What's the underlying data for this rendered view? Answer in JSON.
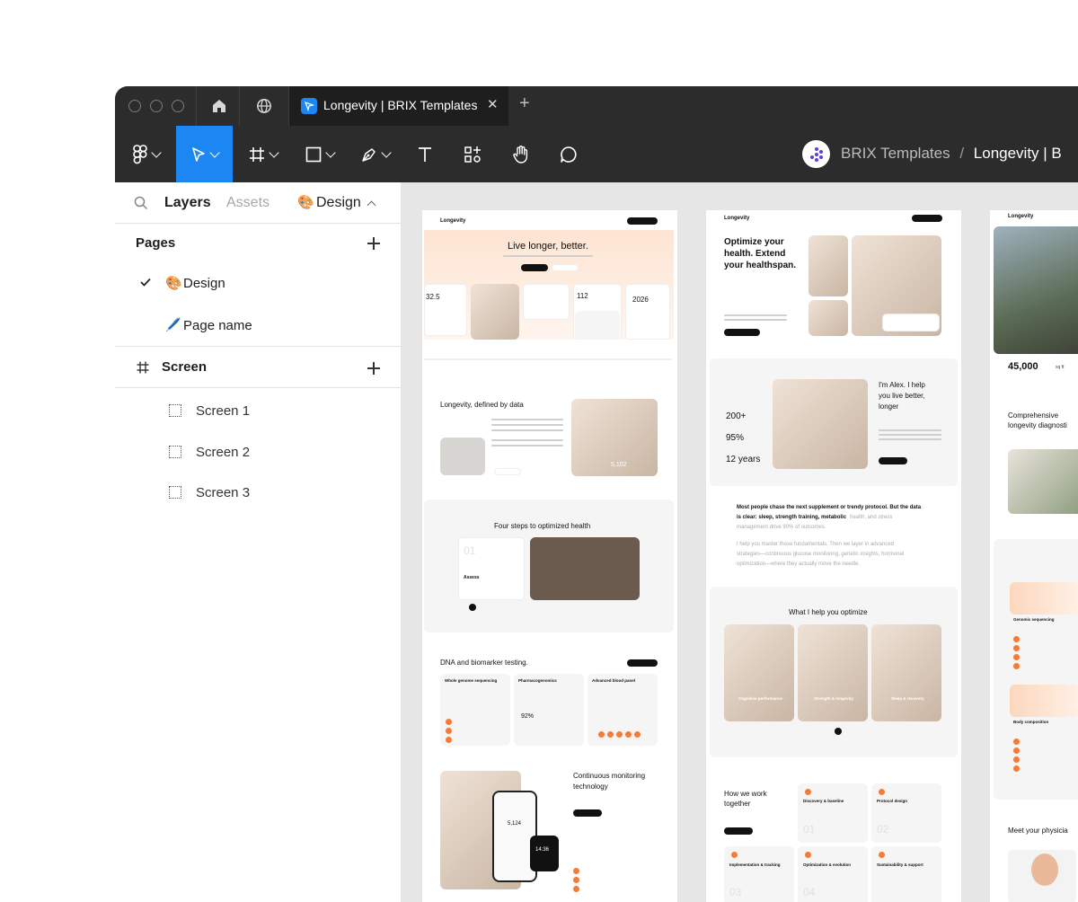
{
  "window": {
    "tab_title": "Longevity | BRIX Templates",
    "tab_close": "✕",
    "tab_add": "+"
  },
  "toolbar": {
    "breadcrumb_team": "BRIX Templates",
    "breadcrumb_separator": "/",
    "breadcrumb_project": "Longevity | B"
  },
  "sidebar": {
    "tabs": {
      "layers": "Layers",
      "assets": "Assets",
      "design": "Design"
    },
    "design_emoji": "🎨",
    "pages_heading": "Pages",
    "pages": [
      {
        "emoji": "🎨",
        "label": "Design",
        "selected": true
      },
      {
        "emoji": "🖊️",
        "label": "Page name",
        "selected": false
      }
    ],
    "frame_name": "Screen",
    "layers": [
      "Screen 1",
      "Screen 2",
      "Screen 3"
    ]
  },
  "canvas": {
    "board1": {
      "logo": "Longevity",
      "hero_title": "Live longer, better.",
      "stat_a": "32.5",
      "stat_b": "112",
      "stat_c": "2026",
      "section2_title": "Longevity, defined by data",
      "stat_steps": "5,102",
      "section3_title": "Four steps to optimized health",
      "step_number": "01",
      "step_name": "Assess",
      "section4_title": "DNA and biomarker testing.",
      "cards": [
        "Whole genome sequencing",
        "Pharmacogenomics",
        "Advanced blood panel"
      ],
      "card_stat": "92%",
      "section5_title_1": "Continuous monitoring",
      "section5_title_2": "technology",
      "phone_stat": "5,124",
      "watch_time": "14:36"
    },
    "board2": {
      "logo": "Longevity",
      "hero_title_1": "Optimize your",
      "hero_title_2": "health. Extend",
      "hero_title_3": "your healthspan.",
      "intro_1": "I'm Alex. I help",
      "intro_2": "you live better,",
      "intro_3": "longer",
      "stats": [
        "200+",
        "95%",
        "12 years"
      ],
      "quote_1": "Most people chase the next supplement or trendy protocol. But the data",
      "quote_2": "is clear: sleep, strength training, metabolic",
      "quote_2_faded": "health, and stress",
      "quote_3": "management drive 90% of outcomes.",
      "quote_4": "I help you master those fundamentals. Then we layer in advanced",
      "quote_5": "strategies—continuous glucose monitoring, genetic insights, hormonal",
      "quote_6": "optimization—where they actually move the needle.",
      "section_title": "What I help you optimize",
      "cards": [
        "Cognitive performance",
        "Strength & longevity",
        "Sleep & recovery"
      ],
      "work_title_1": "How we work",
      "work_title_2": "together",
      "steps": [
        "Discovery & baseline",
        "Protocol design",
        "Implementation & tracking",
        "Optimization & evolution",
        "Sustainability & support"
      ],
      "step_nums": [
        "01",
        "02",
        "03",
        "04"
      ]
    },
    "board3": {
      "logo": "Longevity",
      "stat": "45,000",
      "stat_unit": "sq ft",
      "title_1": "Comprehensive",
      "title_2": "longevity diagnosti",
      "card1": "Genomic sequencing",
      "card2": "Body composition",
      "footer_title": "Meet your physicia"
    }
  }
}
